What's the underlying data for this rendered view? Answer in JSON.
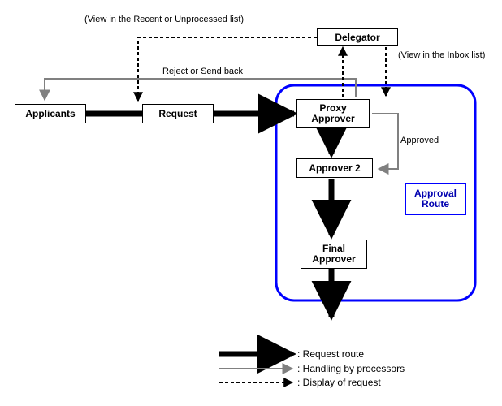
{
  "nodes": {
    "delegator": "Delegator",
    "applicants": "Applicants",
    "request": "Request",
    "proxy": "Proxy Approver",
    "approver2": "Approver 2",
    "final": "Final Approver",
    "approval_route": "Approval Route"
  },
  "edges": {
    "view_recent": "(View in the Recent or Unprocessed list)",
    "reject": "Reject or Send back",
    "view_inbox": "(View in the Inbox list)",
    "approved": "Approved"
  },
  "legend": {
    "request_route": ": Request route",
    "handling": ": Handling by processors",
    "display": ": Display of request"
  }
}
